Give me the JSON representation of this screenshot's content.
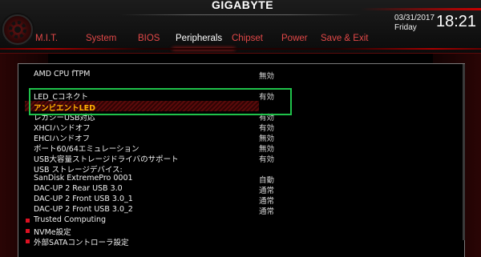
{
  "brand": "GIGABYTE",
  "date": "03/31/2017",
  "day": "Friday",
  "time": "18:21",
  "tabs": [
    "M.I.T.",
    "System",
    "BIOS",
    "Peripherals",
    "Chipset",
    "Power",
    "Save & Exit"
  ],
  "active_tab": "Peripherals",
  "settings": [
    {
      "label": "AMD CPU fTPM",
      "value": "無効"
    },
    {
      "label": "LED_Cコネクト",
      "value": "有効"
    },
    {
      "label": "アンビエントLED",
      "value": ""
    },
    {
      "label": "レガシーUSB対応",
      "value": "有効"
    },
    {
      "label": "XHCIハンドオフ",
      "value": "有効"
    },
    {
      "label": "EHCIハンドオフ",
      "value": "無効"
    },
    {
      "label": "ポート60/64エミュレーション",
      "value": "無効"
    },
    {
      "label": "USB大容量ストレージドライバのサポート",
      "value": "有効"
    },
    {
      "label": "USB ストレージデバイス:",
      "value": ""
    },
    {
      "label": "SanDisk ExtremePro 0001",
      "value": "自動"
    },
    {
      "label": "DAC-UP 2 Rear USB 3.0",
      "value": "通常"
    },
    {
      "label": "DAC-UP 2 Front USB 3.0_1",
      "value": "通常"
    },
    {
      "label": "DAC-UP 2 Front USB 3.0_2",
      "value": "通常"
    }
  ],
  "submenus": [
    "Trusted Computing",
    "NVMe設定",
    "外部SATAコントローラ設定"
  ],
  "colors": {
    "accent": "#e00000",
    "highlight_text": "#ffb400",
    "annotation_box": "#1fc24a"
  }
}
